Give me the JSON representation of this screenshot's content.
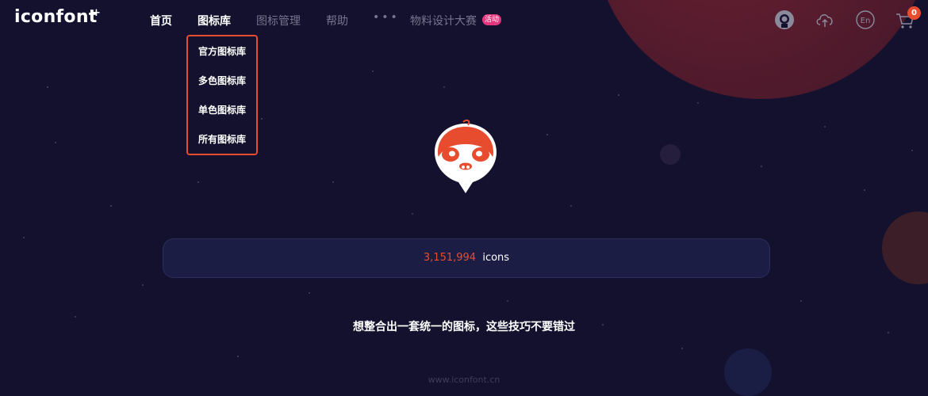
{
  "colors": {
    "background": "#13112d",
    "accent": "#e84c2f",
    "badge": "#e5367e"
  },
  "header": {
    "logo": "iconfont",
    "logo_plus": "+",
    "nav": {
      "home": "首页",
      "library": "图标库",
      "manage": "图标管理",
      "help": "帮助",
      "more": "•••",
      "contest": "物料设计大赛",
      "contest_badge": "活动"
    },
    "icons": [
      "user-avatar-icon",
      "upload-cloud-icon",
      "language-en-icon",
      "cart-icon"
    ],
    "lang_label": "En",
    "cart_count": "0"
  },
  "dropdown": {
    "items": [
      "官方图标库",
      "多色图标库",
      "单色图标库",
      "所有图标库"
    ]
  },
  "search": {
    "count": "3,151,994",
    "unit": "icons"
  },
  "headline": "想整合出一套统一的图标，这些技巧不要错过",
  "footer": "www.iconfont.cn"
}
